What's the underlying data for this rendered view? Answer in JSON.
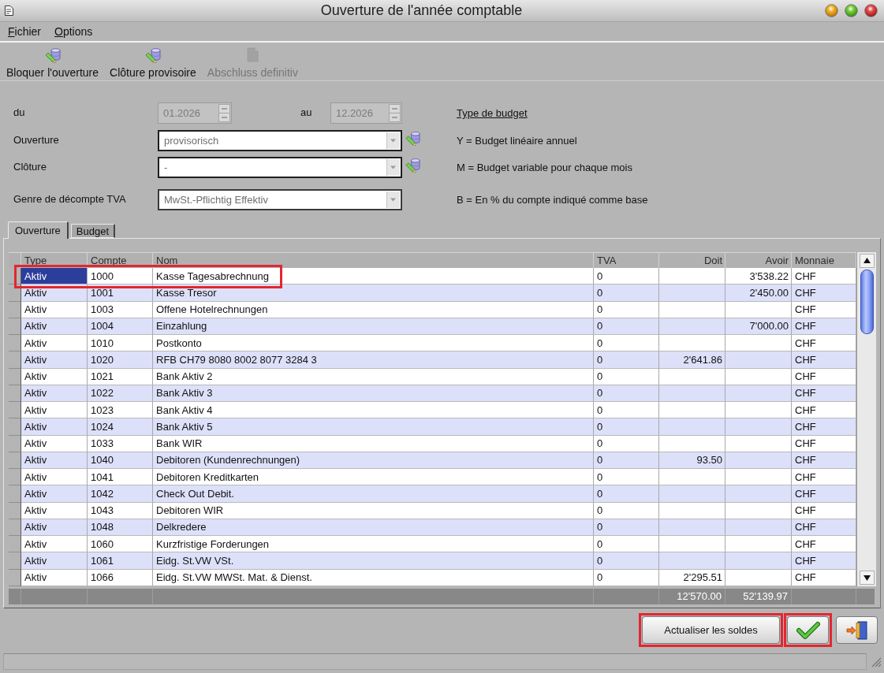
{
  "window": {
    "title": "Ouverture de l'année comptable"
  },
  "menu": [
    {
      "label": "Fichier"
    },
    {
      "label": "Options"
    }
  ],
  "toolbar": [
    {
      "label": "Bloquer l'ouverture",
      "disabled": false
    },
    {
      "label": "Clôture provisoire",
      "disabled": false
    },
    {
      "label": "Abschluss definitiv",
      "disabled": true
    }
  ],
  "form": {
    "period": {
      "from_label": "du",
      "from_value": "01.2026",
      "to_label": "au",
      "to_value": "12.2026"
    },
    "fields": [
      {
        "label": "Ouverture",
        "value": "provisorisch",
        "has_action": true
      },
      {
        "label": "Clôture",
        "value": "-",
        "has_action": true
      },
      {
        "label": "Genre de décompte TVA",
        "value": "MwSt.-Pflichtig Effektiv",
        "has_action": false
      }
    ],
    "budget_legend": {
      "title": "Type de budget",
      "lines": [
        "Y = Budget linéaire annuel",
        "M = Budget variable pour chaque mois",
        "B = En % du compte indiqué comme base"
      ]
    }
  },
  "tabs": [
    {
      "label": "Ouverture",
      "selected": true
    },
    {
      "label": "Budget",
      "selected": false
    }
  ],
  "table": {
    "columns": [
      {
        "label": "Type"
      },
      {
        "label": "Compte"
      },
      {
        "label": "Nom"
      },
      {
        "label": "TVA"
      },
      {
        "label": "Doit"
      },
      {
        "label": "Avoir"
      },
      {
        "label": "Monnaie"
      }
    ],
    "rows": [
      {
        "type": "Aktiv",
        "account": "1000",
        "name": "Kasse Tagesabrechnung",
        "vat": "0",
        "credit": "3'538.22",
        "currency": "CHF",
        "selected": true,
        "highlighted": true
      },
      {
        "type": "Aktiv",
        "account": "1001",
        "name": "Kasse Tresor",
        "vat": "0",
        "credit": "2'450.00",
        "currency": "CHF",
        "selected": false,
        "highlighted": false
      },
      {
        "type": "Aktiv",
        "account": "1003",
        "name": "Offene Hotelrechnungen",
        "vat": "0",
        "currency": "CHF",
        "selected": false,
        "highlighted": false
      },
      {
        "type": "Aktiv",
        "account": "1004",
        "name": "Einzahlung",
        "vat": "0",
        "credit": "7'000.00",
        "currency": "CHF",
        "selected": false,
        "highlighted": false
      },
      {
        "type": "Aktiv",
        "account": "1010",
        "name": "Postkonto",
        "vat": "0",
        "currency": "CHF",
        "selected": false,
        "highlighted": false
      },
      {
        "type": "Aktiv",
        "account": "1020",
        "name": "RFB CH79 8080 8002 8077 3284 3",
        "vat": "0",
        "debit": "2'641.86",
        "currency": "CHF",
        "selected": false,
        "highlighted": false
      },
      {
        "type": "Aktiv",
        "account": "1021",
        "name": "Bank Aktiv 2",
        "vat": "0",
        "currency": "CHF",
        "selected": false,
        "highlighted": false
      },
      {
        "type": "Aktiv",
        "account": "1022",
        "name": "Bank Aktiv 3",
        "vat": "0",
        "currency": "CHF",
        "selected": false,
        "highlighted": false
      },
      {
        "type": "Aktiv",
        "account": "1023",
        "name": "Bank Aktiv 4",
        "vat": "0",
        "currency": "CHF",
        "selected": false,
        "highlighted": false
      },
      {
        "type": "Aktiv",
        "account": "1024",
        "name": "Bank Aktiv 5",
        "vat": "0",
        "currency": "CHF",
        "selected": false,
        "highlighted": false
      },
      {
        "type": "Aktiv",
        "account": "1033",
        "name": "Bank WIR",
        "vat": "0",
        "currency": "CHF",
        "selected": false,
        "highlighted": false
      },
      {
        "type": "Aktiv",
        "account": "1040",
        "name": "Debitoren (Kundenrechnungen)",
        "vat": "0",
        "debit": "93.50",
        "currency": "CHF",
        "selected": false,
        "highlighted": false
      },
      {
        "type": "Aktiv",
        "account": "1041",
        "name": "Debitoren Kreditkarten",
        "vat": "0",
        "currency": "CHF",
        "selected": false,
        "highlighted": false
      },
      {
        "type": "Aktiv",
        "account": "1042",
        "name": "Check Out Debit.",
        "vat": "0",
        "currency": "CHF",
        "selected": false,
        "highlighted": false
      },
      {
        "type": "Aktiv",
        "account": "1043",
        "name": "Debitoren WIR",
        "vat": "0",
        "currency": "CHF",
        "selected": false,
        "highlighted": false
      },
      {
        "type": "Aktiv",
        "account": "1048",
        "name": "Delkredere",
        "vat": "0",
        "currency": "CHF",
        "selected": false,
        "highlighted": false
      },
      {
        "type": "Aktiv",
        "account": "1060",
        "name": "Kurzfristige Forderungen",
        "vat": "0",
        "currency": "CHF",
        "selected": false,
        "highlighted": false
      },
      {
        "type": "Aktiv",
        "account": "1061",
        "name": "Eidg. St.VW VSt.",
        "vat": "0",
        "currency": "CHF",
        "selected": false,
        "highlighted": false
      },
      {
        "type": "Aktiv",
        "account": "1066",
        "name": "Eidg. St.VW MWSt. Mat. & Dienst.",
        "vat": "0",
        "debit": "2'295.51",
        "currency": "CHF",
        "selected": false,
        "highlighted": false
      }
    ],
    "totals": {
      "debit": "12'570.00",
      "credit": "52'139.97"
    }
  },
  "buttons": [
    {
      "kind": "text",
      "label": "Actualiser les soldes",
      "highlighted": true
    },
    {
      "kind": "confirm",
      "highlighted": true
    },
    {
      "kind": "exit",
      "highlighted": false
    }
  ]
}
